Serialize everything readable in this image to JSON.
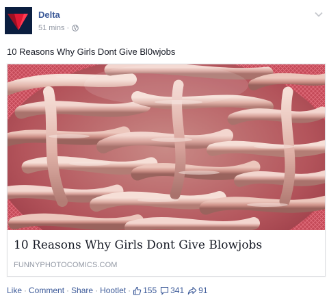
{
  "post": {
    "author": "Delta",
    "timestamp": "51 mins",
    "separator": "·",
    "privacy_icon": "globe-icon",
    "options_icon": "chevron-down-icon",
    "message": "10 Reasons Why Girls Dont Give Bl0wjobs"
  },
  "attachment": {
    "title": "10 Reasons Why Girls Dont Give Blowjobs",
    "domain": "FUNNYPHOTOCOMICS.COM"
  },
  "actions": {
    "like_label": "Like",
    "comment_label": "Comment",
    "share_label": "Share",
    "hootlet_label": "Hootlet",
    "dot": "·",
    "likes_count": "155",
    "comments_count": "341",
    "shares_count": "91"
  },
  "colors": {
    "link_blue": "#3b5998",
    "meta_gray": "#9197a3",
    "text": "#141823",
    "delta_red": "#e01933",
    "delta_navy": "#0b1e3f"
  }
}
